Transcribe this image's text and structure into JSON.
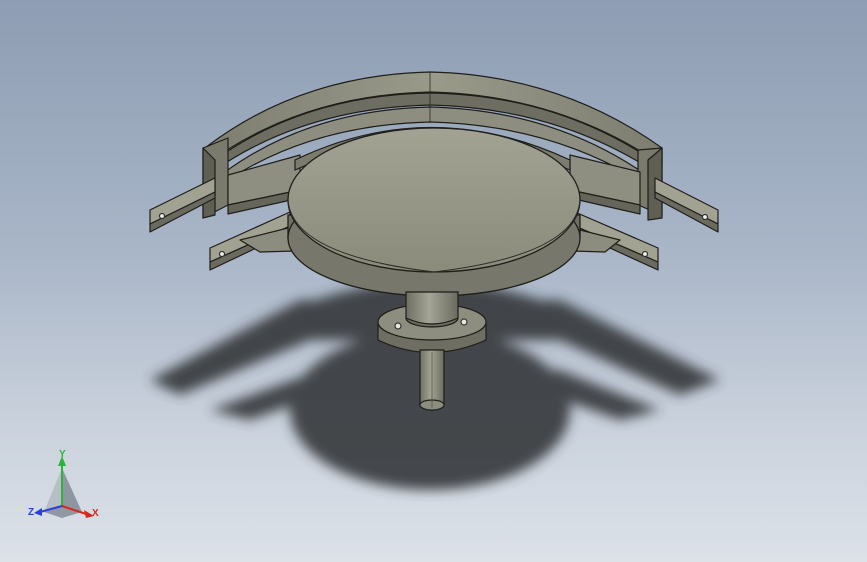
{
  "viewport": {
    "background_top": "#8e9db3",
    "background_bottom": "#dde2e9"
  },
  "model": {
    "part_color": "#8a8a7a",
    "part_light": "#9b9b8b",
    "part_dark": "#5e5e52",
    "edge_color": "#1e1e1a",
    "shadow_color": "#3a3d40"
  },
  "triad": {
    "x_label": "X",
    "y_label": "Y",
    "z_label": "Z",
    "x_color": "#d9271e",
    "y_color": "#2bb33a",
    "z_color": "#2a3fd6"
  }
}
